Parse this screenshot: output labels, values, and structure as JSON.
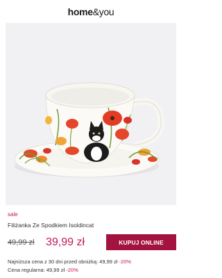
{
  "header": {
    "logo_strong": "home",
    "logo_light": "&you"
  },
  "product": {
    "badge": "sale",
    "name": "Filiżanka Ze Spodkiem Isoldincat",
    "old_price": "49,99 zł",
    "new_price": "39,99 zł",
    "buy_label": "KUPUJ ONLINE",
    "lowest_price_text": "Najniższa cena z 30 dni przed obniżką: 49,99 zł",
    "lowest_price_discount": "-20%",
    "regular_price_text": "Cena regularna: 49,99 zł",
    "regular_price_discount": "-20%"
  },
  "colors": {
    "accent": "#c2185b",
    "button": "#a3133f",
    "image_background": "#f1f1f3"
  }
}
